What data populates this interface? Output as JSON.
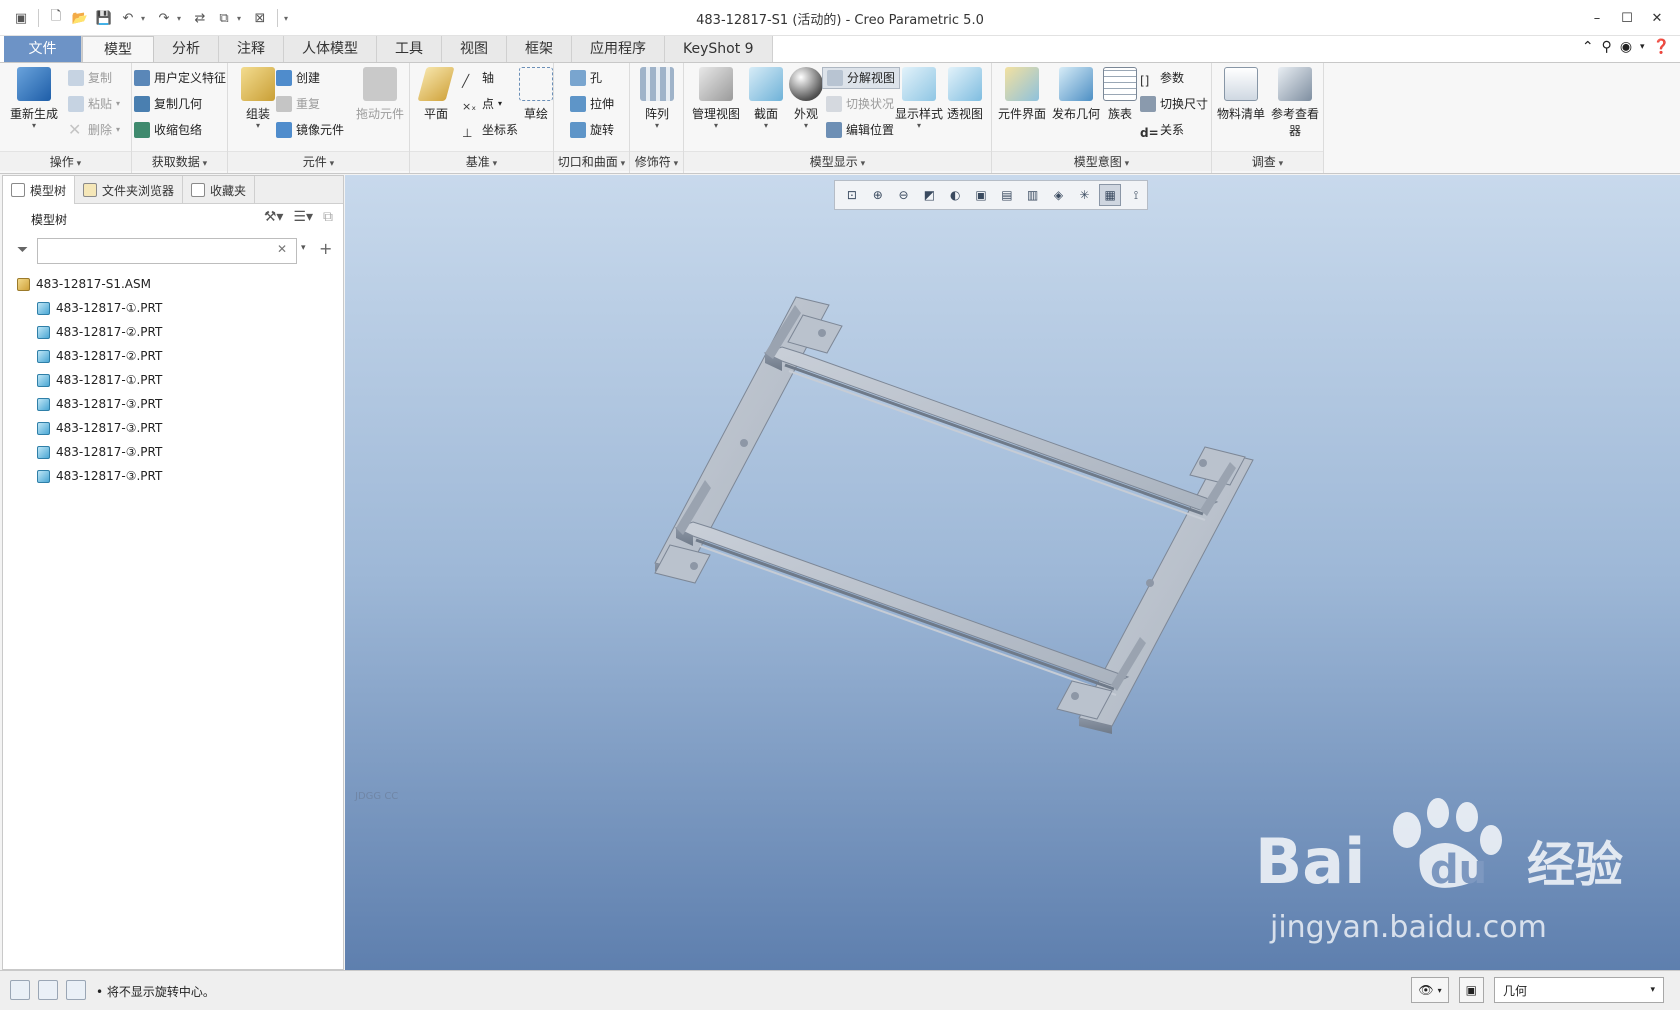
{
  "window": {
    "title": "483-12817-S1 (活动的) - Creo Parametric 5.0",
    "controls": [
      "–",
      "☐",
      "✕"
    ]
  },
  "ribbon_tabs": [
    "文件",
    "模型",
    "分析",
    "注释",
    "人体模型",
    "工具",
    "视图",
    "框架",
    "应用程序",
    "KeyShot 9"
  ],
  "active_tab": "模型",
  "groups": {
    "operations": {
      "label": "操作",
      "regen": "重新生成",
      "copy": "复制",
      "paste": "粘贴",
      "delete": "删除"
    },
    "get_data": {
      "label": "获取数据",
      "udf": "用户定义特征",
      "copy_geom": "复制几何",
      "shrinkwrap": "收缩包络"
    },
    "component": {
      "label": "元件",
      "assemble": "组装",
      "create": "创建",
      "repeat": "重复",
      "mirror": "镜像元件",
      "drag": "拖动元件"
    },
    "datum": {
      "label": "基准",
      "plane": "平面",
      "axis": "轴",
      "point": "点",
      "csys": "坐标系",
      "sketch": "草绘"
    },
    "cut_surface": {
      "label": "切口和曲面",
      "hole": "孔",
      "extrude": "拉伸",
      "revolve": "旋转"
    },
    "modifiers": {
      "label": "修饰符",
      "pattern": "阵列"
    },
    "model_display": {
      "label": "模型显示",
      "manage_views": "管理视图",
      "section": "截面",
      "appearance": "外观",
      "explode": "分解视图",
      "toggle_status": "切换状况",
      "edit_position": "编辑位置",
      "display_style": "显示样式",
      "perspective": "透视图"
    },
    "model_intent": {
      "label": "模型意图",
      "component_interface": "元件界面",
      "publish_geom": "发布几何",
      "family_table": "族表",
      "parameters": "参数",
      "switch_dims": "切换尺寸",
      "relations": "关系"
    },
    "investigate": {
      "label": "调查",
      "bom": "物料清单",
      "ref_viewer": "参考查看器"
    }
  },
  "panel": {
    "tabs": [
      "模型树",
      "文件夹浏览器",
      "收藏夹"
    ],
    "tree_header": "模型树",
    "search_placeholder": "",
    "root": "483-12817-S1.ASM",
    "items": [
      "483-12817-①.PRT",
      "483-12817-②.PRT",
      "483-12817-②.PRT",
      "483-12817-①.PRT",
      "483-12817-③.PRT",
      "483-12817-③.PRT",
      "483-12817-③.PRT",
      "483-12817-③.PRT"
    ]
  },
  "graphics": {
    "small_label": "JDGG CC",
    "watermark_logo": "Bai du 经验",
    "watermark_url": "jingyan.baidu.com"
  },
  "status": {
    "message": "• 将不显示旋转中心。",
    "filter": "几何"
  },
  "colors": {
    "file_tab": "#6d93c6",
    "viewport_top": "#c8d9ec",
    "viewport_bottom": "#5e7fae",
    "model_part": "#b8c0cc"
  }
}
